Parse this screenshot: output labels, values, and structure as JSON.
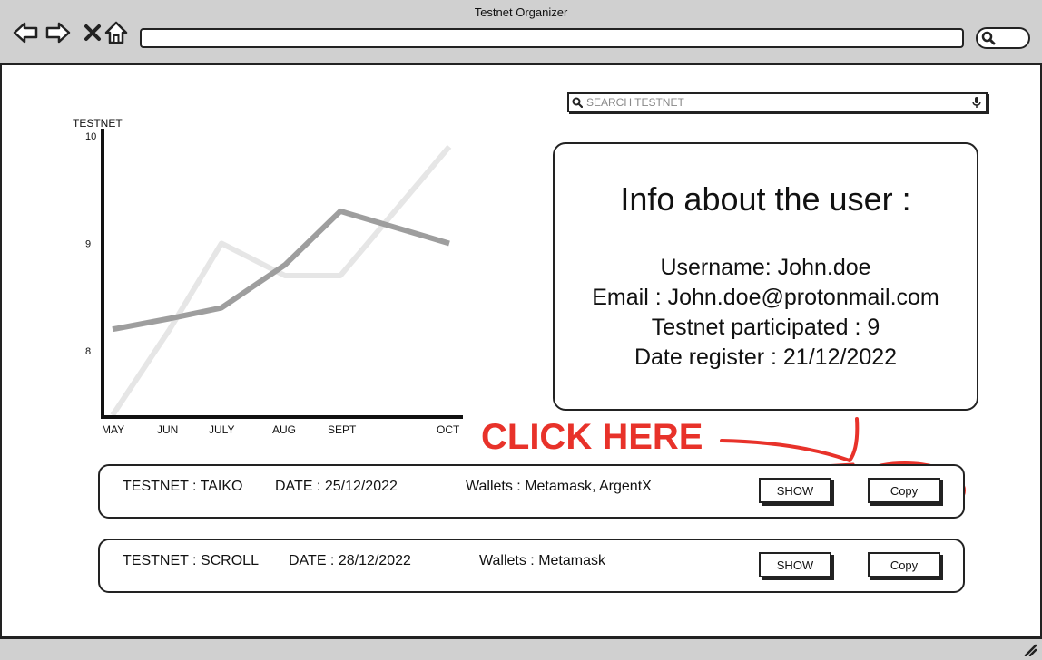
{
  "window": {
    "title": "Testnet Organizer"
  },
  "icons": {
    "back": "back-arrow-icon",
    "forward": "forward-arrow-icon",
    "close": "close-icon",
    "home": "home-icon",
    "search": "search-icon",
    "mic": "microphone-icon",
    "resize": "resize-grip-icon"
  },
  "search": {
    "placeholder": "SEARCH TESTNET"
  },
  "chart_data": {
    "type": "line",
    "categories": [
      "MAY",
      "JUN",
      "JULY",
      "AUG",
      "SEPT",
      "OCT"
    ],
    "ylabel": "TESTNET",
    "y_ticks": [
      "10",
      "9",
      "8"
    ],
    "ylim": [
      7.4,
      10
    ],
    "series": [
      {
        "values": [
          7.4,
          8.2,
          9.0,
          8.7,
          8.7,
          9.9
        ],
        "color": "#e6e6e6"
      },
      {
        "values": [
          8.2,
          8.3,
          8.4,
          8.8,
          9.3,
          9.0
        ],
        "color": "#9e9e9e"
      }
    ]
  },
  "info": {
    "heading": "Info about the user :",
    "username": "Username: John.doe",
    "email": "Email : John.doe@protonmail.com",
    "testnets": "Testnet participated : 9",
    "date": "Date register : 21/12/2022"
  },
  "annotation": {
    "text": "CLICK HERE",
    "color": "#e8322a"
  },
  "rows": [
    {
      "testnet": "TESTNET : TAIKO",
      "date": "DATE : 25/12/2022",
      "wallets": "Wallets : Metamask, ArgentX",
      "show_label": "SHOW",
      "copy_label": "Copy"
    },
    {
      "testnet": "TESTNET : SCROLL",
      "date": "DATE : 28/12/2022",
      "wallets": "Wallets : Metamask",
      "show_label": "SHOW",
      "copy_label": "Copy"
    }
  ]
}
